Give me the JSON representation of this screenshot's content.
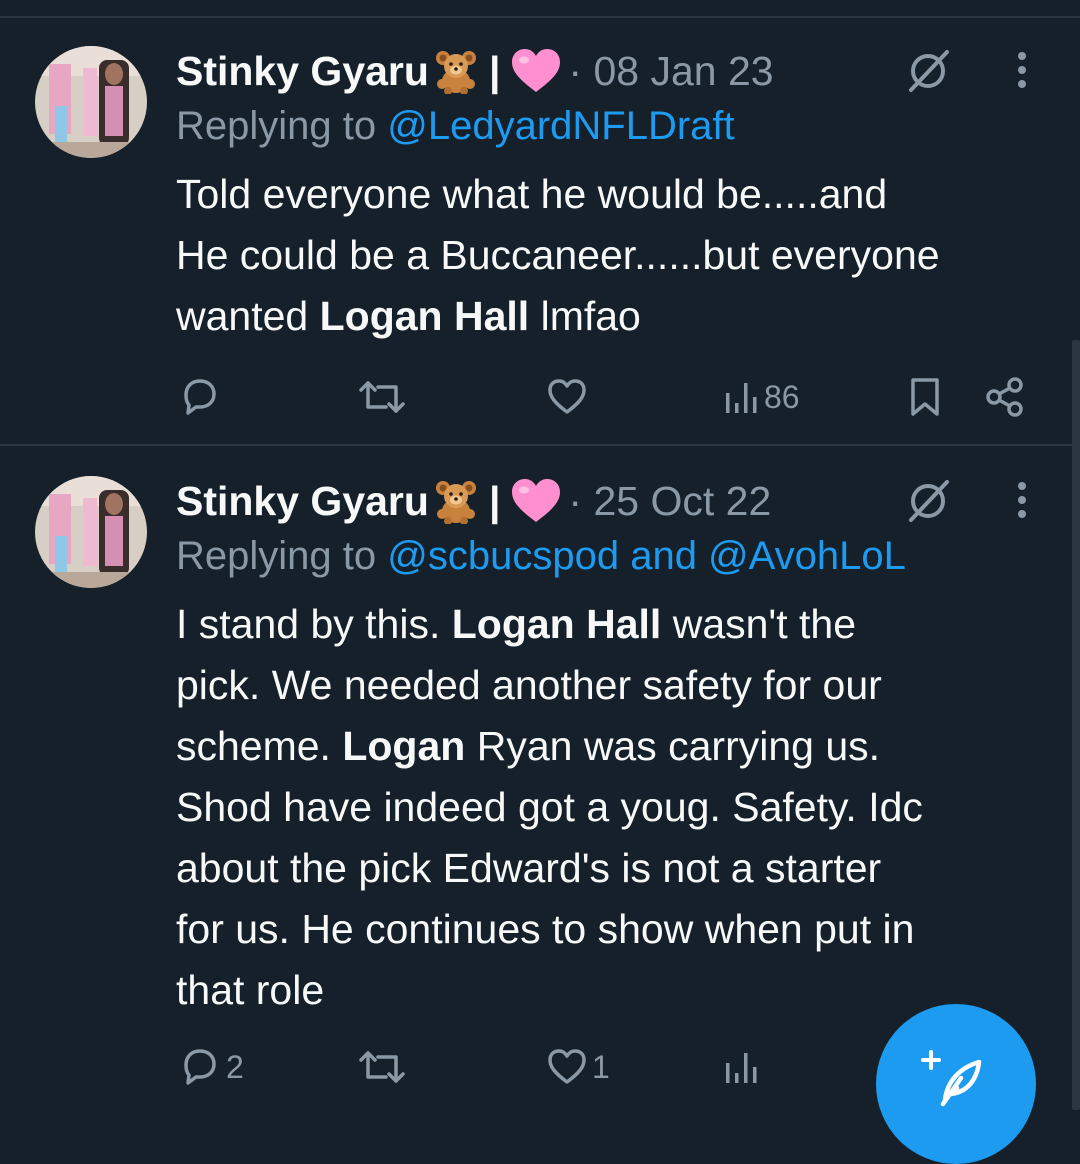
{
  "tweets": [
    {
      "author": "Stinky Gyaru",
      "pipe": "|",
      "date": "· 08 Jan 23",
      "replying_prefix": "Replying to",
      "replying_to": "@LedyardNFLDraft",
      "body": {
        "line1": "Told everyone what he would be.....and",
        "line2": "He could be a Buccaneer......but everyone",
        "line3_pre": "wanted ",
        "line3_bold": "Logan Hall",
        "line3_post": " lmfao"
      },
      "actions": {
        "reply_count": "",
        "retweet_count": "",
        "like_count": "",
        "views_count": "86"
      }
    },
    {
      "author": "Stinky Gyaru",
      "pipe": "|",
      "date": "· 25 Oct 22",
      "replying_prefix": "Replying to",
      "replying_to": "@scbucspod and @AvohLoL",
      "body": {
        "l1_pre": "I stand by this. ",
        "l1_bold": "Logan Hall",
        "l1_post": " wasn't the",
        "l2": "pick. We needed another safety for our",
        "l3_pre": "scheme. ",
        "l3_bold": "Logan",
        "l3_post": " Ryan was carrying us.",
        "l4": "Shod have indeed got a youg. Safety. Idc",
        "l5": "about the pick Edward's is not a starter",
        "l6": "for us. He continues to show when put in",
        "l7": "that role"
      },
      "actions": {
        "reply_count": "2",
        "retweet_count": "",
        "like_count": "1",
        "views_count": ""
      }
    }
  ],
  "icons": {
    "author_emoji_1": "teddy-bear-emoji",
    "author_emoji_2": "pink-heart-emoji",
    "grok": "grok-icon",
    "more": "more-vertical-icon",
    "reply": "reply-icon",
    "retweet": "retweet-icon",
    "like": "heart-icon",
    "views": "views-icon",
    "bookmark": "bookmark-icon",
    "share": "share-icon",
    "compose": "compose-feather-icon"
  },
  "colors": {
    "background": "#15202b",
    "accent": "#1d9bf0",
    "secondary_text": "#8b98a5",
    "heart_emoji": "#ff8fce"
  }
}
